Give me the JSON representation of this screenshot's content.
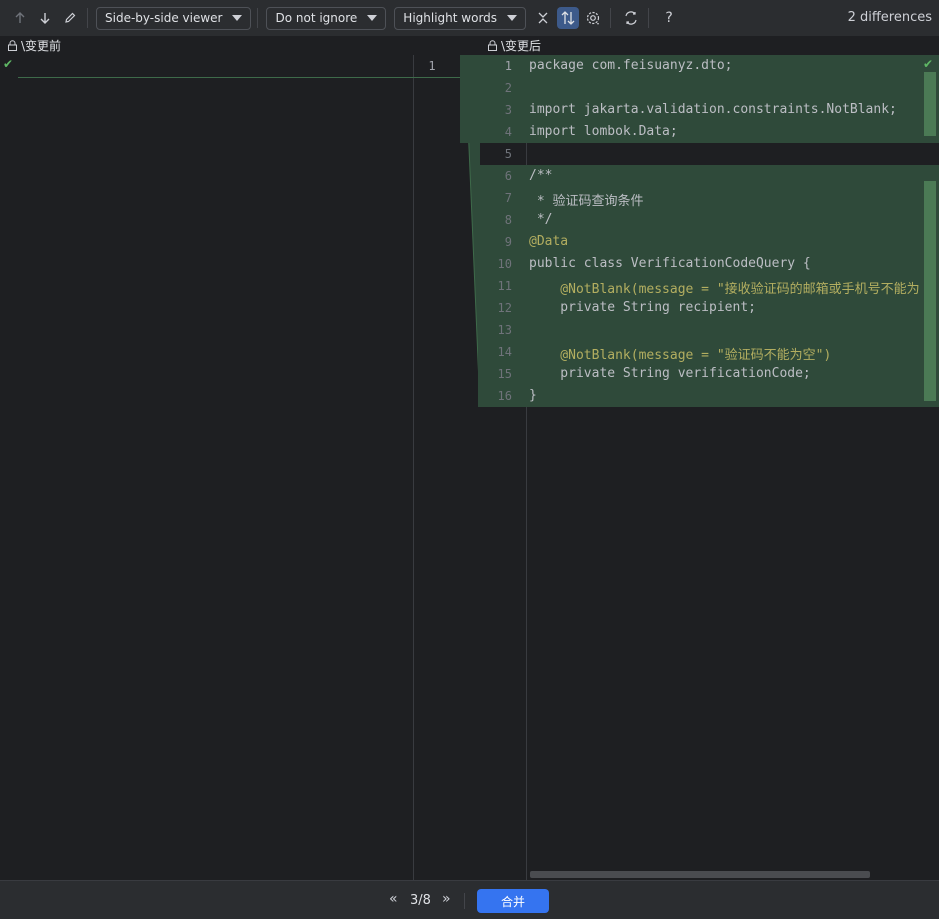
{
  "toolbar": {
    "prev_diff": "arrow-up-icon",
    "next_diff": "arrow-down-icon",
    "edit": "pencil-icon",
    "viewer_mode": "Side-by-side viewer",
    "whitespace_mode": "Do not ignore",
    "highlight_mode": "Highlight words",
    "diff_count": "2 differences"
  },
  "left_pane": {
    "title": "\\变更前",
    "line_number": "1"
  },
  "right_pane": {
    "title": "\\变更后",
    "lines": [
      {
        "n": "1",
        "text": "package com.feisuanyz.dto;"
      },
      {
        "n": "2",
        "text": ""
      },
      {
        "n": "3",
        "text": "import jakarta.validation.constraints.NotBlank;"
      },
      {
        "n": "4",
        "text": "import lombok.Data;"
      },
      {
        "n": "5",
        "text": ""
      },
      {
        "n": "6",
        "text": "/**"
      },
      {
        "n": "7",
        "text": " * 验证码查询条件"
      },
      {
        "n": "8",
        "text": " */"
      },
      {
        "n": "9",
        "text": "@Data"
      },
      {
        "n": "10",
        "text": "public class VerificationCodeQuery {"
      },
      {
        "n": "11",
        "text": "    @NotBlank(message = \"接收验证码的邮箱或手机号不能为"
      },
      {
        "n": "12",
        "text": "    private String recipient;"
      },
      {
        "n": "13",
        "text": ""
      },
      {
        "n": "14",
        "text": "    @NotBlank(message = \"验证码不能为空\")"
      },
      {
        "n": "15",
        "text": "    private String verificationCode;"
      },
      {
        "n": "16",
        "text": "}"
      }
    ]
  },
  "bottom": {
    "counter": "3/8",
    "merge_label": "合并"
  },
  "colors": {
    "accent": "#3574f0",
    "inserted_bg": "#2f4a3a",
    "marker": "#4b7a55"
  }
}
